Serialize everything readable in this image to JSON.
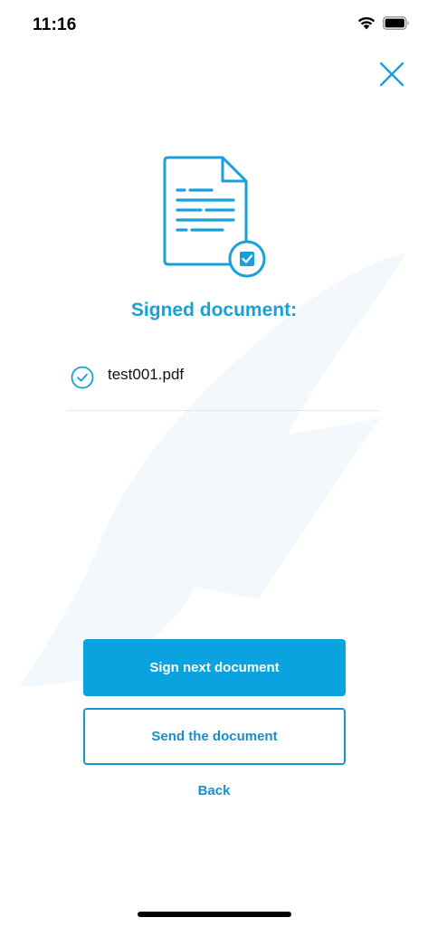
{
  "status_bar": {
    "time": "11:16",
    "icons": [
      "wifi-icon",
      "battery-icon"
    ]
  },
  "header": {
    "close_icon": "close-icon"
  },
  "illustration": {
    "icon": "signed-document-icon"
  },
  "content": {
    "title": "Signed document:",
    "files": [
      {
        "name": "test001.pdf",
        "status_icon": "check-circle-icon"
      }
    ]
  },
  "actions": {
    "sign_next_label": "Sign next document",
    "send_label": "Send the document",
    "back_label": "Back"
  },
  "colors": {
    "accent": "#0aa3df",
    "title": "#1aa0d8",
    "link": "#1a8ec8",
    "watermark": "#f2f8fc"
  }
}
